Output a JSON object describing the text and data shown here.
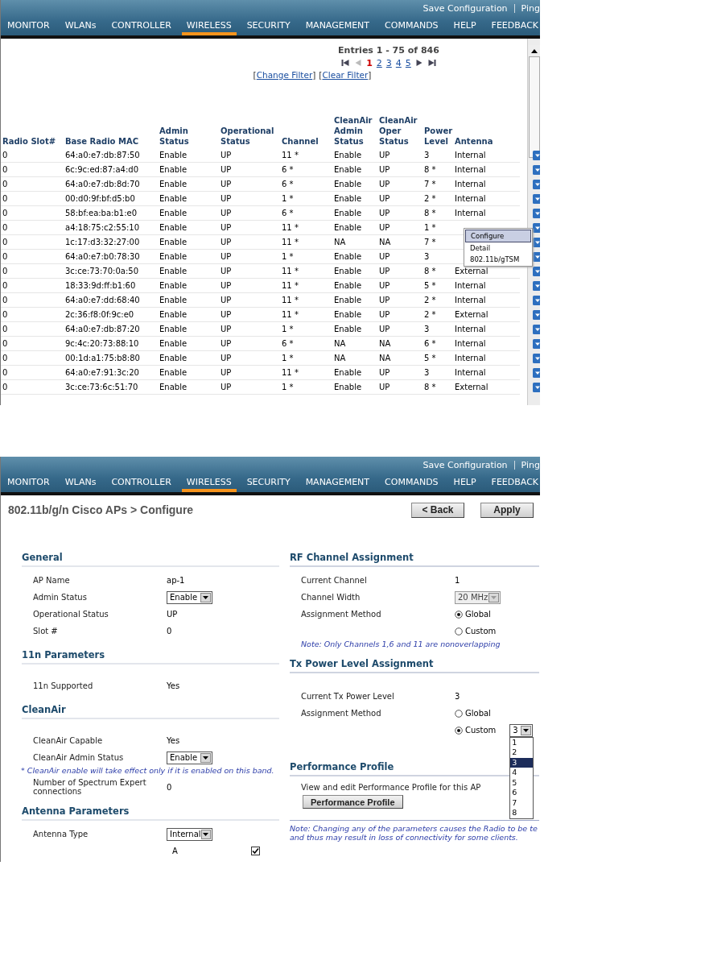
{
  "list_screen": {
    "top_links": [
      "Save Configuration",
      "Ping"
    ],
    "nav": [
      {
        "label": "MONITOR",
        "selected": false
      },
      {
        "label": "WLANs",
        "selected": false
      },
      {
        "label": "CONTROLLER",
        "selected": false
      },
      {
        "label": "WIRELESS",
        "selected": true
      },
      {
        "label": "SECURITY",
        "selected": false
      },
      {
        "label": "MANAGEMENT",
        "selected": false
      },
      {
        "label": "COMMANDS",
        "selected": false
      },
      {
        "label": "HELP",
        "selected": false
      },
      {
        "label": "FEEDBACK",
        "selected": false
      }
    ],
    "entries": "Entries 1 - 75 of 846",
    "pager_controls": [
      {
        "kind": "first",
        "disabled": false
      },
      {
        "kind": "prev",
        "disabled": true
      }
    ],
    "pages": [
      {
        "label": "1",
        "selected": true
      },
      {
        "label": "2",
        "selected": false
      },
      {
        "label": "3",
        "selected": false
      },
      {
        "label": "4",
        "selected": false
      },
      {
        "label": "5",
        "selected": false
      }
    ],
    "pager_controls_end": [
      {
        "kind": "next",
        "disabled": false
      },
      {
        "kind": "last",
        "disabled": false
      }
    ],
    "filters": {
      "open": "[",
      "close": "]",
      "links": [
        "Change Filter",
        "Clear Filter"
      ]
    },
    "columns": [
      "Radio Slot#",
      "Base Radio MAC",
      "Admin Status",
      "Operational Status",
      "Channel",
      "CleanAir Admin Status",
      "CleanAir Oper Status",
      "Power Level",
      "Antenna"
    ],
    "rows": [
      {
        "cells": [
          "0",
          "64:a0:e7:db:87:50",
          "Enable",
          "UP",
          "11 *",
          "Enable",
          "UP",
          "3",
          "Internal"
        ],
        "menu_open": false
      },
      {
        "cells": [
          "0",
          "6c:9c:ed:87:a4:d0",
          "Enable",
          "UP",
          "6 *",
          "Enable",
          "UP",
          "8 *",
          "Internal"
        ],
        "menu_open": false
      },
      {
        "cells": [
          "0",
          "64:a0:e7:db:8d:70",
          "Enable",
          "UP",
          "6 *",
          "Enable",
          "UP",
          "7 *",
          "Internal"
        ],
        "menu_open": false
      },
      {
        "cells": [
          "0",
          "00:d0:9f:bf:d5:b0",
          "Enable",
          "UP",
          "1 *",
          "Enable",
          "UP",
          "2 *",
          "Internal"
        ],
        "menu_open": false
      },
      {
        "cells": [
          "0",
          "58:bf:ea:ba:b1:e0",
          "Enable",
          "UP",
          "6 *",
          "Enable",
          "UP",
          "8 *",
          "Internal"
        ],
        "menu_open": false
      },
      {
        "cells": [
          "0",
          "a4:18:75:c2:55:10",
          "Enable",
          "UP",
          "11 *",
          "Enable",
          "UP",
          "1 *"
        ],
        "menu_open": true
      },
      {
        "cells": [
          "0",
          "1c:17:d3:32:27:00",
          "Enable",
          "UP",
          "11 *",
          "NA",
          "NA",
          "7 *"
        ],
        "menu_open": false
      },
      {
        "cells": [
          "0",
          "64:a0:e7:b0:78:30",
          "Enable",
          "UP",
          "1 *",
          "Enable",
          "UP",
          "3"
        ],
        "menu_open": false
      },
      {
        "cells": [
          "0",
          "3c:ce:73:70:0a:50",
          "Enable",
          "UP",
          "11 *",
          "Enable",
          "UP",
          "8 *",
          "External"
        ],
        "menu_open": false
      },
      {
        "cells": [
          "0",
          "18:33:9d:ff:b1:60",
          "Enable",
          "UP",
          "11 *",
          "Enable",
          "UP",
          "5 *",
          "Internal"
        ],
        "menu_open": false
      },
      {
        "cells": [
          "0",
          "64:a0:e7:dd:68:40",
          "Enable",
          "UP",
          "11 *",
          "Enable",
          "UP",
          "2 *",
          "Internal"
        ],
        "menu_open": false
      },
      {
        "cells": [
          "0",
          "2c:36:f8:0f:9c:e0",
          "Enable",
          "UP",
          "11 *",
          "Enable",
          "UP",
          "2 *",
          "External"
        ],
        "menu_open": false
      },
      {
        "cells": [
          "0",
          "64:a0:e7:db:87:20",
          "Enable",
          "UP",
          "1 *",
          "Enable",
          "UP",
          "3",
          "Internal"
        ],
        "menu_open": false
      },
      {
        "cells": [
          "0",
          "9c:4c:20:73:88:10",
          "Enable",
          "UP",
          "6 *",
          "NA",
          "NA",
          "6 *",
          "Internal"
        ],
        "menu_open": false
      },
      {
        "cells": [
          "0",
          "00:1d:a1:75:b8:80",
          "Enable",
          "UP",
          "1 *",
          "NA",
          "NA",
          "5 *",
          "Internal"
        ],
        "menu_open": false
      },
      {
        "cells": [
          "0",
          "64:a0:e7:91:3c:20",
          "Enable",
          "UP",
          "11 *",
          "Enable",
          "UP",
          "3",
          "Internal"
        ],
        "menu_open": false
      },
      {
        "cells": [
          "0",
          "3c:ce:73:6c:51:70",
          "Enable",
          "UP",
          "1 *",
          "Enable",
          "UP",
          "8 *",
          "External"
        ],
        "menu_open": false
      }
    ],
    "row_menu": [
      {
        "label": "Configure",
        "selected": true
      },
      {
        "label": "Detail",
        "selected": false
      },
      {
        "label": "802.11b/gTSM",
        "selected": false
      }
    ]
  },
  "config_screen": {
    "top_links": [
      "Save Configuration",
      "Ping"
    ],
    "nav": [
      {
        "label": "MONITOR",
        "selected": false
      },
      {
        "label": "WLANs",
        "selected": false
      },
      {
        "label": "CONTROLLER",
        "selected": false
      },
      {
        "label": "WIRELESS",
        "selected": true
      },
      {
        "label": "SECURITY",
        "selected": false
      },
      {
        "label": "MANAGEMENT",
        "selected": false
      },
      {
        "label": "COMMANDS",
        "selected": false
      },
      {
        "label": "HELP",
        "selected": false
      },
      {
        "label": "FEEDBACK",
        "selected": false
      }
    ],
    "title": "802.11b/g/n Cisco APs > Configure",
    "buttons": [
      "< Back",
      "Apply"
    ],
    "left_sections": [
      {
        "title": "General",
        "rows": [
          {
            "kind": "text",
            "label": "AP Name",
            "value": "ap-1"
          },
          {
            "kind": "select",
            "label": "Admin Status",
            "value": "Enable",
            "disabled": false
          },
          {
            "kind": "text",
            "label": "Operational Status",
            "value": "UP"
          },
          {
            "kind": "text",
            "label": "Slot #",
            "value": "0"
          }
        ]
      },
      {
        "title": "11n Parameters",
        "rows": [
          {
            "kind": "text",
            "label": "11n Supported",
            "value": "Yes"
          }
        ]
      },
      {
        "title": "CleanAir",
        "rows": [
          {
            "kind": "text",
            "label": "CleanAir Capable",
            "value": "Yes"
          },
          {
            "kind": "select",
            "label": "CleanAir Admin Status",
            "value": "Enable",
            "disabled": false
          },
          {
            "kind": "note",
            "text": "* CleanAir enable will take effect only if it is enabled on this band."
          },
          {
            "kind": "text",
            "label": "Number of Spectrum Expert connections",
            "value": "0"
          }
        ]
      },
      {
        "title": "Antenna Parameters",
        "rows": [
          {
            "kind": "select",
            "label": "Antenna Type",
            "value": "Internal",
            "disabled": false
          },
          {
            "kind": "checkbox",
            "label": "A",
            "checked": true
          }
        ]
      }
    ],
    "right_sections": [
      {
        "title": "RF Channel Assignment",
        "rows": [
          {
            "kind": "text",
            "label": "Current Channel",
            "value": "1"
          },
          {
            "kind": "select",
            "label": "Channel Width",
            "value": "20 MHz",
            "disabled": true
          },
          {
            "kind": "radio",
            "label": "Assignment Method",
            "value": "Global",
            "selected": true
          },
          {
            "kind": "radio",
            "value": "Custom",
            "selected": false
          },
          {
            "kind": "note",
            "text": "Note: Only Channels 1,6 and 11 are nonoverlapping"
          }
        ]
      },
      {
        "title": "Tx Power Level Assignment",
        "rows": [
          {
            "kind": "text",
            "label": "Current Tx Power Level",
            "value": "3"
          },
          {
            "kind": "radio",
            "label": "Assignment Method",
            "value": "Global",
            "selected": false
          },
          {
            "kind": "radio",
            "value": "Custom",
            "selected": true,
            "select": {
              "value": "3",
              "options": [
                {
                  "label": "1",
                  "selected": false
                },
                {
                  "label": "2",
                  "selected": false
                },
                {
                  "label": "3",
                  "selected": true
                },
                {
                  "label": "4",
                  "selected": false
                },
                {
                  "label": "5",
                  "selected": false
                },
                {
                  "label": "6",
                  "selected": false
                },
                {
                  "label": "7",
                  "selected": false
                },
                {
                  "label": "8",
                  "selected": false
                }
              ]
            }
          }
        ]
      },
      {
        "title": "Performance Profile",
        "rows": [
          {
            "kind": "paragraph",
            "text": "View and edit Performance Profile for this AP"
          },
          {
            "kind": "button",
            "text": "Performance Profile"
          }
        ]
      }
    ],
    "footer_note": [
      "Note: Changing any of the parameters causes the Radio to be te",
      "and thus may result in loss of connectivity for some clients."
    ]
  }
}
